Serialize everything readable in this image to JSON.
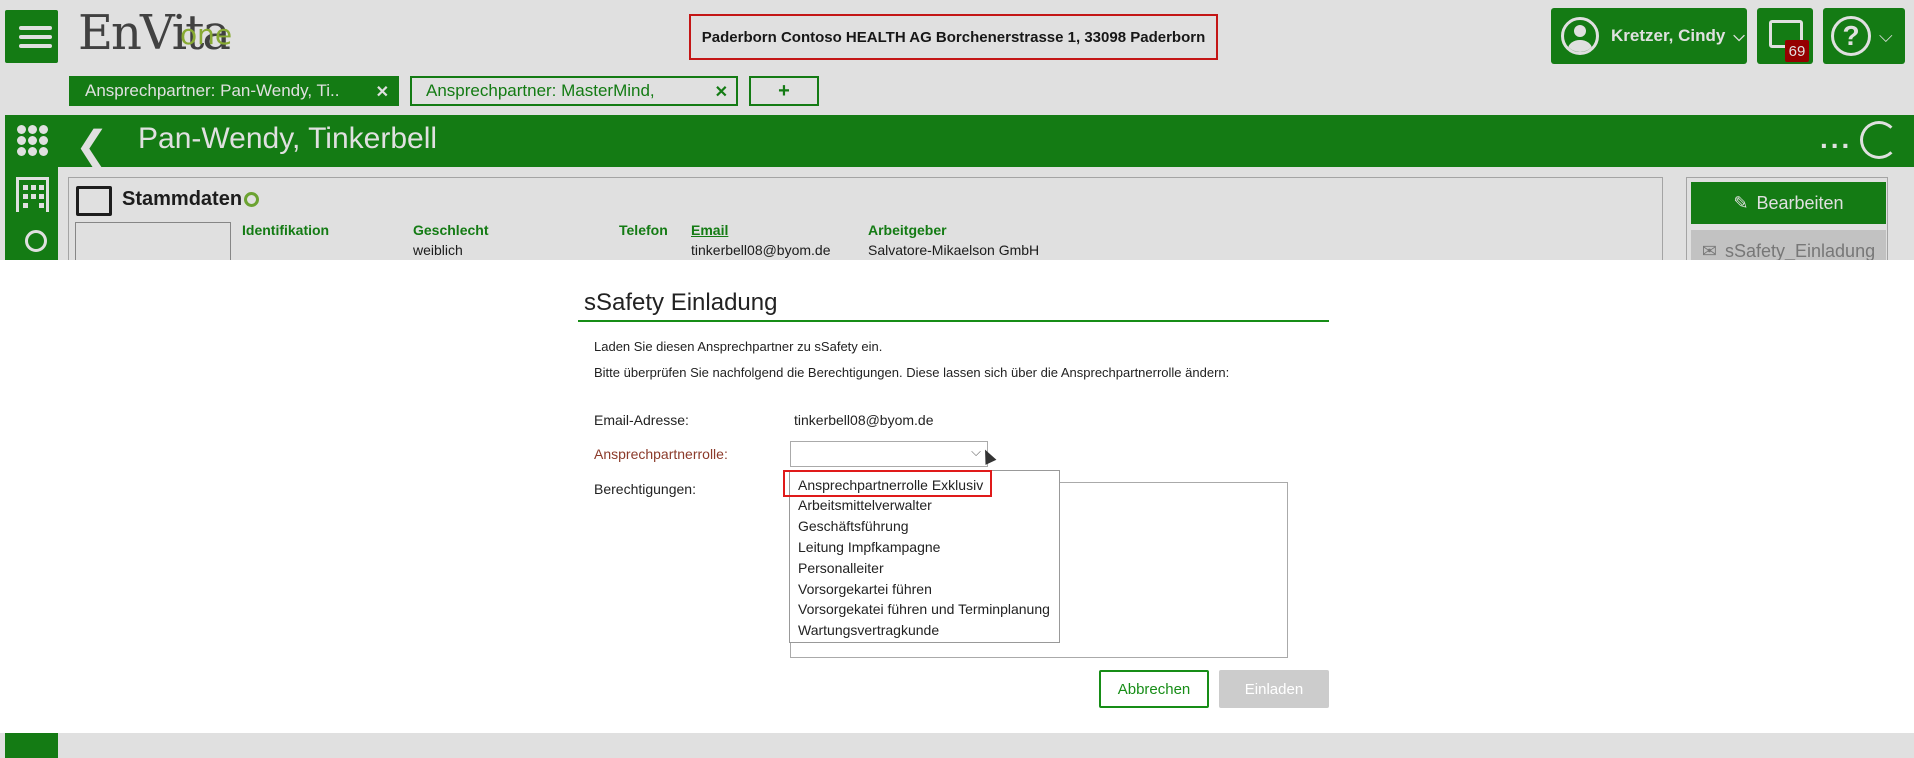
{
  "topbar": {
    "logo_main": "EnVita",
    "logo_suffix": "one",
    "address": "Paderborn Contoso HEALTH AG Borchenerstrasse 1, 33098 Paderborn",
    "user_name": "Kretzer, Cindy",
    "chat_count": "69"
  },
  "tabs": [
    {
      "label": "Ansprechpartner: Pan-Wendy, Ti..",
      "close": "✕"
    },
    {
      "label": "Ansprechpartner: MasterMind,",
      "close": "✕"
    }
  ],
  "tab_add": "+",
  "header": {
    "title": "Pan-Wendy, Tinkerbell",
    "more": "..."
  },
  "card": {
    "title": "Stammdaten",
    "fields": [
      {
        "label": "Identifikation",
        "value": ""
      },
      {
        "label": "Geschlecht",
        "value": "weiblich"
      },
      {
        "label": "Telefon",
        "value": ""
      },
      {
        "label": "Email",
        "value": "tinkerbell08@byom.de"
      },
      {
        "label": "Arbeitgeber",
        "value": "Salvatore-Mikaelson GmbH"
      }
    ]
  },
  "actions": {
    "edit_label": "Bearbeiten",
    "ssafety_label": "sSafety_Einladung"
  },
  "modal": {
    "title": "sSafety Einladung",
    "intro": "Laden Sie diesen Ansprechpartner zu sSafety ein.",
    "note": "Bitte überprüfen Sie nachfolgend die Berechtigungen. Diese lassen sich über die Ansprechpartnerrolle ändern:",
    "email_label": "Email-Adresse:",
    "email_value": "tinkerbell08@byom.de",
    "role_label": "Ansprechpartnerrolle:",
    "role_selected": "",
    "permissions_label": "Berechtigungen:",
    "role_options": [
      "Ansprechpartnerrolle Exklusiv",
      "Arbeitsmittelverwalter",
      "Geschäftsführung",
      "Leitung Impfkampagne",
      "Personalleiter",
      "Vorsorgekartei führen",
      "Vorsorgekatei führen und Terminplanung",
      "Wartungsvertragkunde"
    ],
    "cancel_label": "Abbrechen",
    "invite_label": "Einladen"
  },
  "colors": {
    "brand_green": "#178d17",
    "highlight_red": "#e01a1a",
    "badge_red": "#aa0000"
  }
}
